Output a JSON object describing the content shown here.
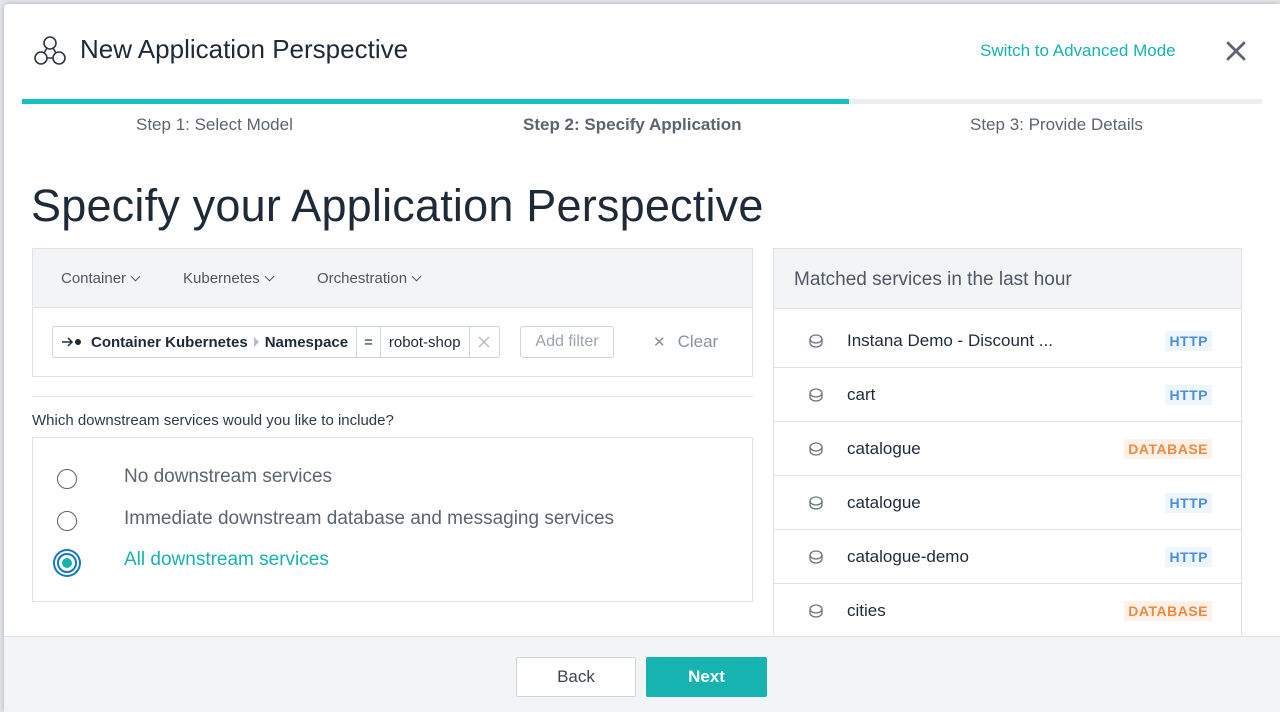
{
  "header": {
    "title": "New Application Perspective",
    "advanced_link": "Switch to Advanced Mode",
    "close_icon": "close-icon",
    "app_icon": "application-perspective-icon"
  },
  "steps": [
    {
      "label": "Step 1: Select Model",
      "active": false
    },
    {
      "label": "Step 2: Specify Application",
      "active": true
    },
    {
      "label": "Step 3: Provide Details",
      "active": false
    }
  ],
  "progress": {
    "completed_steps": 2,
    "total_steps": 3,
    "color": "#14bfbd"
  },
  "page_title": "Specify your Application Perspective",
  "filters": {
    "dropdowns": [
      "Container",
      "Kubernetes",
      "Orchestration"
    ],
    "chip": {
      "tag_prefix": "Container Kubernetes",
      "tag_name": "Namespace",
      "operator": "=",
      "value": "robot-shop"
    },
    "add_filter": "Add filter",
    "clear": "Clear"
  },
  "downstream": {
    "question": "Which downstream services would you like to include?",
    "options": [
      {
        "label": "No downstream services",
        "selected": false
      },
      {
        "label": "Immediate downstream database and messaging services",
        "selected": false
      },
      {
        "label": "All downstream services",
        "selected": true
      }
    ]
  },
  "services": {
    "title": "Matched services in the last hour",
    "items": [
      {
        "name": "Instana Demo - Discount ...",
        "type": "HTTP"
      },
      {
        "name": "cart",
        "type": "HTTP"
      },
      {
        "name": "catalogue",
        "type": "DATABASE"
      },
      {
        "name": "catalogue",
        "type": "HTTP"
      },
      {
        "name": "catalogue-demo",
        "type": "HTTP"
      },
      {
        "name": "cities",
        "type": "DATABASE"
      }
    ]
  },
  "footer": {
    "back": "Back",
    "next": "Next"
  },
  "colors": {
    "accent": "#16b3b0",
    "http_badge": "#4a90d9",
    "database_badge": "#f0883e"
  }
}
